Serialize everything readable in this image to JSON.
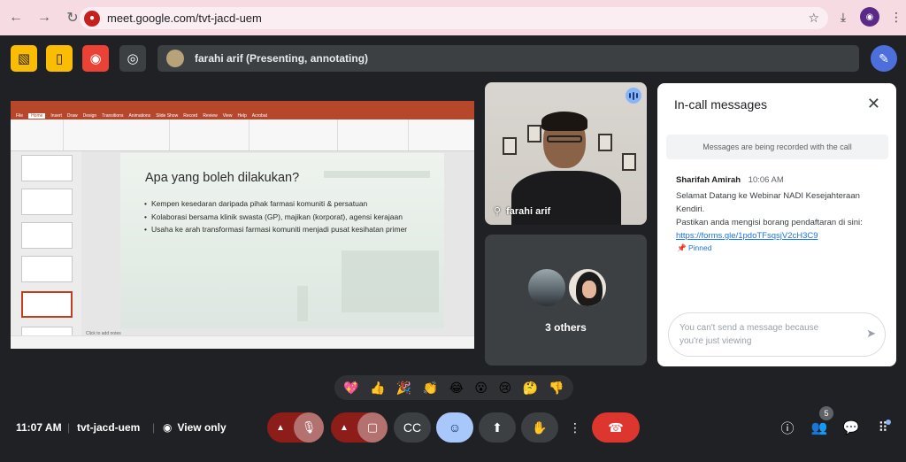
{
  "browser": {
    "url": "meet.google.com/tvt-jacd-uem"
  },
  "meet_top": {
    "presenter_label": "farahi arif (Presenting, annotating)"
  },
  "slide": {
    "title": "Apa yang boleh dilakukan?",
    "bullets": [
      "Kempen kesedaran daripada pihak farmasi komuniti & persatuan",
      "Kolaborasi bersama klinik swasta (GP), majikan (korporat), agensi kerajaan",
      "Usaha ke arah transformasi farmasi komuniti menjadi pusat kesihatan primer"
    ],
    "notes_placeholder": "Click to add notes",
    "ppt_tabs": [
      "File",
      "Home",
      "Insert",
      "Draw",
      "Design",
      "Transitions",
      "Animations",
      "Slide Show",
      "Record",
      "Review",
      "View",
      "Help",
      "Acrobat"
    ]
  },
  "tiles": {
    "main_name": "farahi arif",
    "others_label": "3 others"
  },
  "chat": {
    "title": "In-call messages",
    "recording_note": "Messages are being recorded with the call",
    "sender": "Sharifah Amirah",
    "time": "10:06 AM",
    "line1": "Selamat Datang ke Webinar NADI Kesejahteraan Kendiri.",
    "line2": "Pastikan anda mengisi borang pendaftaran di sini:",
    "link": "https://forms.gle/1pdoTFsqsjV2cH3C9",
    "pinned": "Pinned",
    "input_placeholder": "You can't send a message because you're just viewing"
  },
  "reactions": [
    "💖",
    "👍",
    "🎉",
    "👏",
    "😂",
    "😮",
    "😢",
    "🤔",
    "👎"
  ],
  "bottom": {
    "time": "11:07 AM",
    "meeting_code": "tvt-jacd-uem",
    "view_only": "View only",
    "people_count": "5"
  },
  "colors": {
    "meet_bg": "#202124",
    "end_call": "#dc362e",
    "muted_control": "#8c1d18",
    "reaction_active": "#a8c7fa",
    "accent_link": "#1a73e8"
  }
}
